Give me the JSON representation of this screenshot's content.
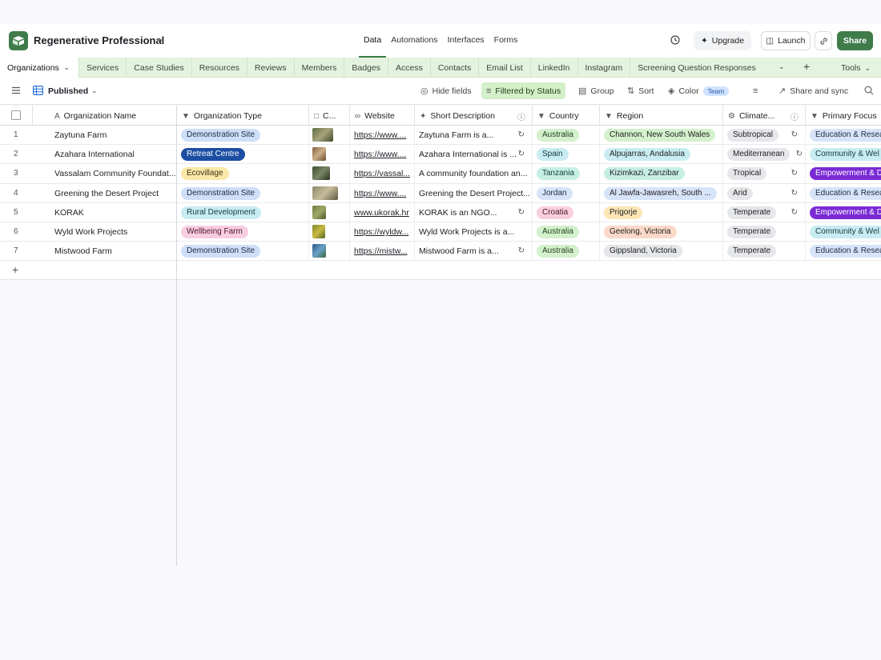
{
  "app": {
    "base_name": "Regenerative Professional",
    "nav": [
      "Data",
      "Automations",
      "Interfaces",
      "Forms"
    ],
    "active_nav": "Data",
    "upgrade_label": "Upgrade",
    "launch_label": "Launch",
    "share_label": "Share",
    "brand_color": "#3f7c4a"
  },
  "tabs": {
    "active": "Organizations",
    "items": [
      "Services",
      "Case Studies",
      "Resources",
      "Reviews",
      "Members",
      "Badges",
      "Access",
      "Contacts",
      "Email List",
      "LinkedIn",
      "Instagram",
      "Screening Question Responses"
    ],
    "tools_label": "Tools"
  },
  "view": {
    "name": "Published",
    "tools": {
      "hide_fields": "Hide fields",
      "filter": "Filtered by Status",
      "group": "Group",
      "sort": "Sort",
      "color": "Color",
      "color_badge": "Team",
      "share_sync": "Share and sync"
    }
  },
  "columns": {
    "org_name": "Organization Name",
    "org_type": "Organization Type",
    "cover": "C...",
    "website": "Website",
    "short_desc": "Short Description",
    "country": "Country",
    "region": "Region",
    "climate": "Climate...",
    "primary_focus": "Primary Focus"
  },
  "rows": [
    {
      "n": "1",
      "name": "Zaytuna Farm",
      "type": "Demonstration Site",
      "website": "https://www....",
      "desc": "Zaytuna Farm is a...",
      "country": "Australia",
      "region": "Channon, New South Wales",
      "climate": "Subtropical",
      "focus": "Education & Resea"
    },
    {
      "n": "2",
      "name": "Azahara International",
      "type": "Retreat Centre",
      "website": "https://www....",
      "desc": "Azahara International is ...",
      "country": "Spain",
      "region": "Alpujarras, Andalusia",
      "climate": "Mediterranean",
      "focus": "Community & Wel"
    },
    {
      "n": "3",
      "name": "Vassalam Community Foundat...",
      "type": "Ecovillage",
      "website": "https://vassal...",
      "desc": "A community foundation an...",
      "country": "Tanzania",
      "region": "Kizimkazi, Zanzibar",
      "climate": "Tropical",
      "focus": "Empowerment & D"
    },
    {
      "n": "4",
      "name": "Greening the Desert Project",
      "type": "Demonstration Site",
      "website": "https://www....",
      "desc": "Greening the Desert Project...",
      "country": "Jordan",
      "region": "Al Jawfa-Jawasreh, South ...",
      "climate": "Arid",
      "focus": "Education & Resea"
    },
    {
      "n": "5",
      "name": "KORAK",
      "type": "Rural Development",
      "website": "www.ukorak.hr",
      "desc": "KORAK is an NGO...",
      "country": "Croatia",
      "region": "Prigorje",
      "climate": "Temperate",
      "focus": "Empowerment & D"
    },
    {
      "n": "6",
      "name": "Wyld Work Projects",
      "type": "Wellbeing Farm",
      "website": "https://wyldw...",
      "desc": "Wyld Work Projects is a...",
      "country": "Australia",
      "region": "Geelong, Victoria",
      "climate": "Temperate",
      "focus": "Community & Wel"
    },
    {
      "n": "7",
      "name": "Mistwood Farm",
      "type": "Demonstration Site",
      "website": "https://mistw...",
      "desc": "Mistwood Farm is a...",
      "country": "Australia",
      "region": "Gippsland, Victoria",
      "climate": "Temperate",
      "focus": "Education & Resea"
    }
  ]
}
